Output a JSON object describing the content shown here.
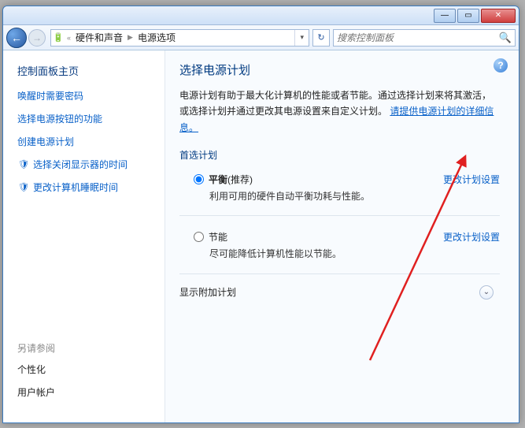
{
  "titlebar": {
    "min": "—",
    "max": "▭",
    "close": "✕"
  },
  "nav": {
    "back": "←",
    "fwd": "→",
    "refresh": "↻"
  },
  "breadcrumb": {
    "seg1": "硬件和声音",
    "seg2": "电源选项"
  },
  "search": {
    "placeholder": "搜索控制面板"
  },
  "sidebar": {
    "title": "控制面板主页",
    "links": {
      "l0": "唤醒时需要密码",
      "l1": "选择电源按钮的功能",
      "l2": "创建电源计划",
      "l3": "选择关闭显示器的时间",
      "l4": "更改计算机睡眠时间"
    },
    "seealso": "另请参阅",
    "b0": "个性化",
    "b1": "用户帐户"
  },
  "main": {
    "heading": "选择电源计划",
    "intro_pre": "电源计划有助于最大化计算机的性能或者节能。通过选择计划来将其激活，或选择计划并通过更改其电源设置来自定义计划。",
    "intro_link": "请提供电源计划的详细信息。",
    "preferred": "首选计划",
    "plan1_name": "平衡",
    "plan1_rec": " (推荐)",
    "plan1_desc": "利用可用的硬件自动平衡功耗与性能。",
    "plan2_name": "节能",
    "plan2_desc": "尽可能降低计算机性能以节能。",
    "change_link": "更改计划设置",
    "additional": "显示附加计划"
  }
}
